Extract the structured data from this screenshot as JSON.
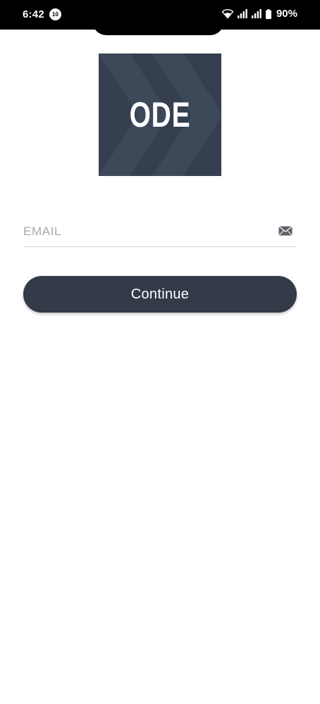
{
  "status_bar": {
    "time": "6:42",
    "notification_badge": "10",
    "battery_percent": "90%",
    "icons": [
      "wifi-icon",
      "signal-icon",
      "signal-icon",
      "battery-icon"
    ]
  },
  "logo": {
    "text": "ODE",
    "background_color": "#353f4f"
  },
  "email_field": {
    "placeholder": "EMAIL",
    "value": "",
    "icon": "mail-icon"
  },
  "continue_button": {
    "label": "Continue",
    "color": "#343b48"
  }
}
